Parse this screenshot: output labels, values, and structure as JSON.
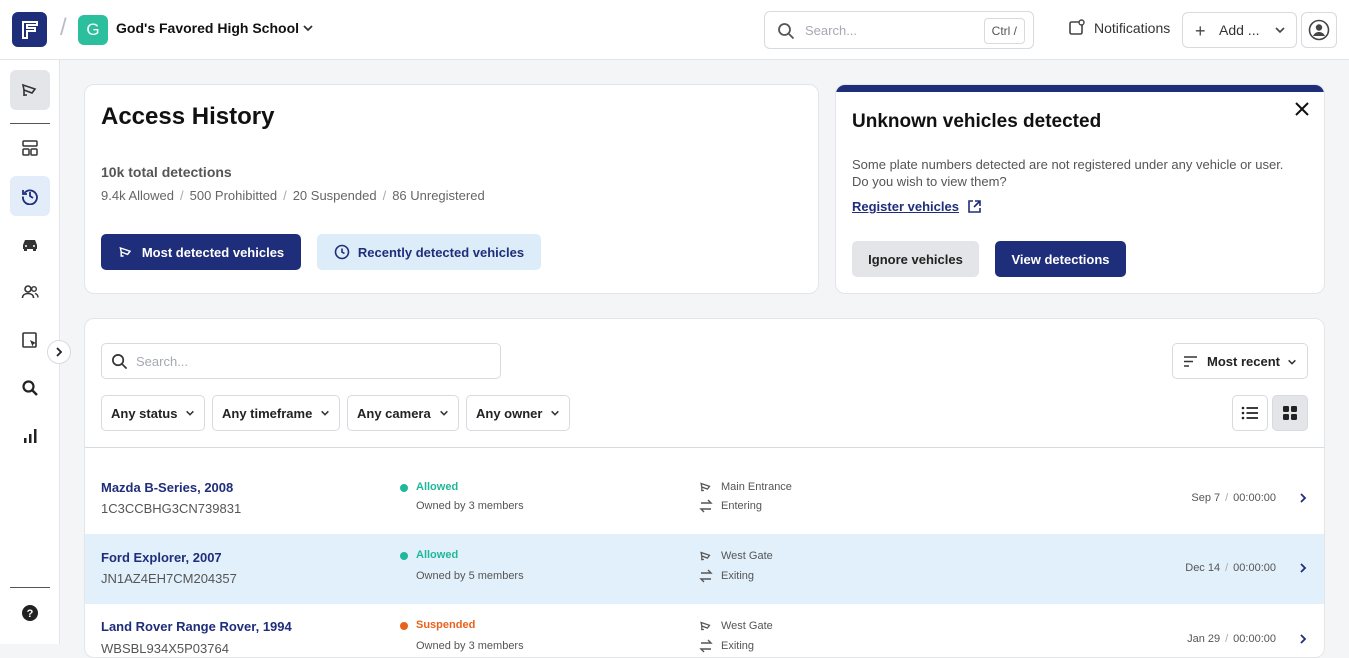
{
  "topbar": {
    "school_initial": "G",
    "school_name": "God's Favored High School",
    "search_placeholder": "Search...",
    "search_shortcut": "Ctrl /",
    "notifications_label": "Notifications",
    "add_label": "Add ..."
  },
  "colors": {
    "brand": "#1f2e7a",
    "school_avatar": "#2bbf9e",
    "allowed": "#1fb89a",
    "suspended": "#e8621c"
  },
  "sidebar": {
    "items": [
      {
        "icon": "camera-icon"
      },
      {
        "icon": "dashboard-icon"
      },
      {
        "icon": "history-icon"
      },
      {
        "icon": "car-icon"
      },
      {
        "icon": "users-icon"
      },
      {
        "icon": "report-icon"
      },
      {
        "icon": "search-icon"
      },
      {
        "icon": "analytics-icon"
      }
    ],
    "help_icon": "help-icon"
  },
  "access_history": {
    "title": "Access History",
    "total": "10k total detections",
    "stats": [
      "9.4k Allowed",
      "500 Prohibitted",
      "20 Suspended",
      "86 Unregistered"
    ],
    "btn_most": "Most detected vehicles",
    "btn_recent": "Recently detected vehicles"
  },
  "unknown": {
    "title": "Unknown vehicles detected",
    "description": "Some plate numbers detected are not registered under any vehicle or user. Do you wish to view them?",
    "link": "Register vehicles",
    "btn_ignore": "Ignore vehicles",
    "btn_view": "View detections"
  },
  "list": {
    "search_placeholder": "Search...",
    "sort_label": "Most recent",
    "filters": [
      "Any status",
      "Any timeframe",
      "Any camera",
      "Any owner"
    ],
    "rows": [
      {
        "name": "Mazda B-Series, 2008",
        "vin": "1C3CCBHG3CN739831",
        "status": "Allowed",
        "owners": "Owned by 3 members",
        "camera": "Main Entrance",
        "direction": "Entering",
        "date": "Sep 7",
        "time": "00:00:00"
      },
      {
        "name": "Ford Explorer, 2007",
        "vin": "JN1AZ4EH7CM204357",
        "status": "Allowed",
        "owners": "Owned by 5 members",
        "camera": "West Gate",
        "direction": "Exiting",
        "date": "Dec 14",
        "time": "00:00:00"
      },
      {
        "name": "Land Rover Range Rover, 1994",
        "vin": "WBSBL934X5P03764",
        "status": "Suspended",
        "owners": "Owned by 3 members",
        "camera": "West Gate",
        "direction": "Exiting",
        "date": "Jan 29",
        "time": "00:00:00"
      }
    ]
  }
}
